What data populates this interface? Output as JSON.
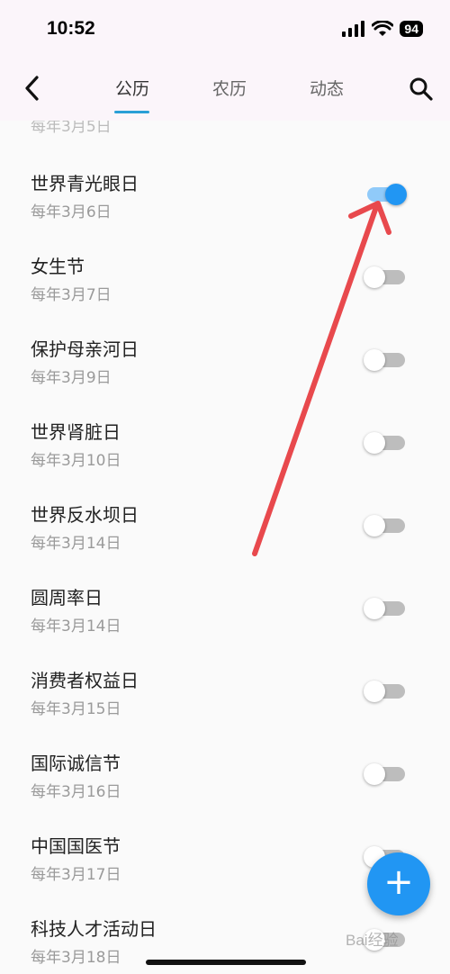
{
  "status_bar": {
    "time": "10:52",
    "battery": "94"
  },
  "header": {
    "back_icon": "chevron-left-icon",
    "search_icon": "search-icon",
    "tabs": [
      {
        "label": "公历",
        "active": true
      },
      {
        "label": "农历",
        "active": false
      },
      {
        "label": "动态",
        "active": false
      }
    ],
    "accent_color": "#2a9fd6"
  },
  "list": {
    "partial_top_item": "每年3月5日",
    "items": [
      {
        "title": "世界青光眼日",
        "date": "每年3月6日",
        "enabled": true
      },
      {
        "title": "女生节",
        "date": "每年3月7日",
        "enabled": false
      },
      {
        "title": "保护母亲河日",
        "date": "每年3月9日",
        "enabled": false
      },
      {
        "title": "世界肾脏日",
        "date": "每年3月10日",
        "enabled": false
      },
      {
        "title": "世界反水坝日",
        "date": "每年3月14日",
        "enabled": false
      },
      {
        "title": "圆周率日",
        "date": "每年3月14日",
        "enabled": false
      },
      {
        "title": "消费者权益日",
        "date": "每年3月15日",
        "enabled": false
      },
      {
        "title": "国际诚信节",
        "date": "每年3月16日",
        "enabled": false
      },
      {
        "title": "中国国医节",
        "date": "每年3月17日",
        "enabled": false
      },
      {
        "title": "科技人才活动日",
        "date": "每年3月18日",
        "enabled": false
      }
    ]
  },
  "fab": {
    "label": "+",
    "color": "#2196f3"
  },
  "switch_on_color": "#2196f3",
  "annotation_color": "#e8494d",
  "watermark": "Bai经验"
}
